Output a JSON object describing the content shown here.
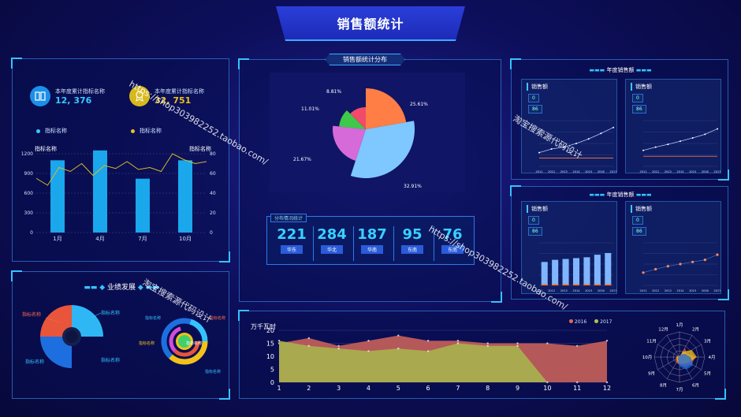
{
  "header": {
    "title": "销售额统计"
  },
  "kpi": {
    "items": [
      {
        "label": "本年度累计指标名称",
        "value": "12, 376",
        "color": "#39c8ff"
      },
      {
        "label": "本年度累计指标名称",
        "value": "32, 751",
        "color": "#e8c021"
      }
    ],
    "legend": [
      "指标名称",
      "指标名称"
    ]
  },
  "left_bar": {
    "left_axis_title": "指标名称",
    "right_axis_title": "指标名称",
    "y_ticks": [
      "1200",
      "900",
      "600",
      "300",
      "0"
    ],
    "y2_ticks": [
      "80",
      "60",
      "40",
      "20",
      "0"
    ],
    "x_labels": [
      "1月",
      "4月",
      "7月",
      "10月"
    ]
  },
  "performance": {
    "title": "业绩发展",
    "labels_left": [
      "指标名称",
      "指标名称",
      "指标名称",
      "指标名称"
    ],
    "labels_right": [
      "指标名称",
      "指标名称",
      "指标名称",
      "指标名称",
      "指标名称"
    ]
  },
  "center_pie": {
    "title": "销售额统计分布",
    "labels": [
      "25.61%",
      "32.91%",
      "21.67%",
      "11.01%",
      "8.81%"
    ]
  },
  "distribution": {
    "title": "分布情况统计",
    "items": [
      {
        "value": "221",
        "label": "华东"
      },
      {
        "value": "284",
        "label": "华北"
      },
      {
        "value": "187",
        "label": "华南"
      },
      {
        "value": "95",
        "label": "东南"
      },
      {
        "value": "76",
        "label": "东南"
      }
    ]
  },
  "annual_sales": {
    "title": "年度销售额",
    "panels": [
      {
        "title": "销售额",
        "chips": [
          "0",
          "86"
        ]
      },
      {
        "title": "销售额",
        "chips": [
          "0",
          "86"
        ]
      }
    ]
  },
  "annual_volume": {
    "title": "年度销售额",
    "panels": [
      {
        "title": "销售额",
        "chips": [
          "0",
          "86"
        ]
      },
      {
        "title": "销售额",
        "chips": [
          "0",
          "86"
        ]
      }
    ]
  },
  "years": [
    "2011",
    "2012",
    "2013",
    "2014",
    "2015",
    "2016",
    "2017"
  ],
  "area_chart": {
    "unit": "万千瓦时",
    "legend": [
      "2016",
      "2017"
    ],
    "y_ticks": [
      "20",
      "15",
      "10",
      "5",
      "0"
    ],
    "x_labels": [
      "1",
      "2",
      "3",
      "4",
      "5",
      "6",
      "7",
      "8",
      "9",
      "10",
      "11",
      "12"
    ]
  },
  "radar": {
    "months": [
      "1月",
      "2月",
      "3月",
      "4月",
      "5月",
      "6月",
      "7月",
      "8月",
      "9月",
      "10月",
      "11月",
      "12月"
    ]
  },
  "watermarks": [
    "https://shop303982252.taobao.com/",
    "淘宝搜索源代码设计"
  ],
  "chart_data": [
    {
      "type": "bar",
      "categories": [
        "1月",
        "4月",
        "7月",
        "10月"
      ],
      "series": [
        {
          "values": [
            1100,
            1250,
            820,
            1100
          ]
        },
        {
          "values": [
            60,
            68,
            55,
            62
          ]
        }
      ],
      "xlabel": "指标名称",
      "ylabel": "指标名称",
      "ylim": [
        0,
        1200
      ]
    },
    {
      "type": "pie",
      "categories": [
        "25.61%",
        "32.91%",
        "21.67%",
        "11.01%",
        "8.81%"
      ],
      "values": [
        25.61,
        32.91,
        21.67,
        11.01,
        8.81
      ]
    },
    {
      "type": "area",
      "categories": [
        "1",
        "2",
        "3",
        "4",
        "5",
        "6",
        "7",
        "8",
        "9",
        "10",
        "11",
        "12"
      ],
      "series": [
        {
          "name": "2016",
          "values": [
            15,
            17,
            14,
            16,
            18,
            16,
            16,
            15,
            15,
            15,
            14,
            16
          ]
        },
        {
          "name": "2017",
          "values": [
            16,
            14,
            13,
            12,
            13,
            12,
            15,
            14,
            14,
            0,
            0,
            0
          ]
        }
      ],
      "ylim": [
        0,
        20
      ]
    }
  ]
}
